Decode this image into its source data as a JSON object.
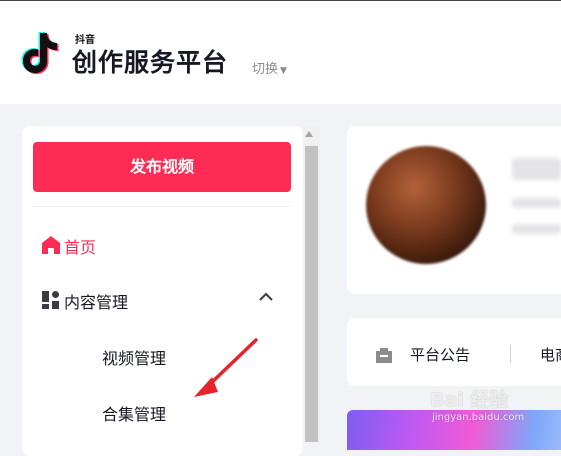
{
  "header": {
    "logo_small": "抖音",
    "logo_title": "创作服务平台",
    "switch_label": "切换"
  },
  "sidebar": {
    "publish_label": "发布视频",
    "items": [
      {
        "label": "首页",
        "icon": "home-icon",
        "active": true
      },
      {
        "label": "内容管理",
        "icon": "grid-icon",
        "expanded": true,
        "children": [
          {
            "label": "视频管理"
          },
          {
            "label": "合集管理"
          }
        ]
      }
    ]
  },
  "notice": {
    "label": "平台公告",
    "next_label": "电商"
  },
  "watermark": {
    "text": "Bai 经验",
    "url": "jingyan.baidu.com"
  },
  "colors": {
    "brand": "#fe2c55",
    "text": "#161823",
    "muted": "#8a8b91"
  }
}
